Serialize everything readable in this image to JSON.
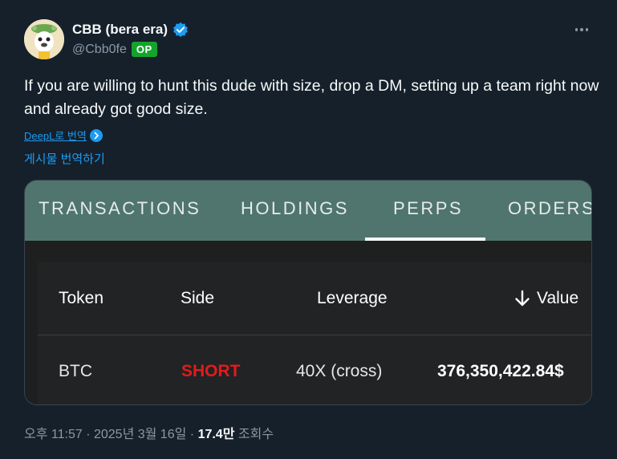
{
  "author": {
    "display_name": "CBB (bera era)",
    "handle": "@Cbb0fe",
    "op_badge": "OP",
    "verified_icon": "verified-badge-icon",
    "avatar_icon": "avatar-image"
  },
  "tweet": {
    "text": "If you are willing to hunt this dude with size, drop a DM, setting up a team right now and already got good size.",
    "deepl_label": "DeepL로 번역",
    "translate_label": "게시물 번역하기"
  },
  "card": {
    "tabs": [
      "TRANSACTIONS",
      "HOLDINGS",
      "PERPS",
      "ORDERS"
    ],
    "active_tab": "PERPS",
    "headers": {
      "token": "Token",
      "side": "Side",
      "leverage": "Leverage",
      "value": "Value"
    },
    "value_sort_icon": "arrow-down-icon",
    "rows": [
      {
        "token": "BTC",
        "side": "SHORT",
        "leverage": "40X (cross)",
        "value": "376,350,422.84$"
      }
    ],
    "colors": {
      "tab_bar": "#4f756e",
      "short": "#e21b1b"
    }
  },
  "meta": {
    "time": "오후 11:57",
    "date": "2025년 3월 16일",
    "views": "17.4만",
    "views_label": "조회수"
  },
  "colors": {
    "background": "#15202b",
    "accent": "#1d9bf0",
    "badge": "#14a42c"
  }
}
